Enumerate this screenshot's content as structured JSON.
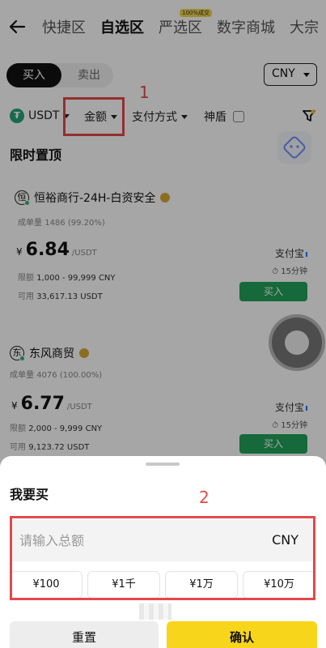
{
  "nav": {
    "tabs": [
      {
        "label": "快捷区"
      },
      {
        "label": "自选区"
      },
      {
        "label": "严选区",
        "badge": "100%成交"
      },
      {
        "label": "数字商城"
      },
      {
        "label": "大宗"
      }
    ]
  },
  "trade": {
    "buy_label": "买入",
    "sell_label": "卖出",
    "currency": "CNY"
  },
  "filters": {
    "coin": "USDT",
    "amount": "金额",
    "payment": "支付方式",
    "shield": "神盾"
  },
  "annotations": {
    "label1": "1",
    "label2": "2"
  },
  "section_title": "限时置顶",
  "cards": [
    {
      "merchant": "恒裕商行-24H-白资安全",
      "avatar_char": "恒",
      "stats_label": "成单量",
      "stats_value": "1486 (99.20%)",
      "currency_symbol": "¥",
      "price": "6.84",
      "unit": "/USDT",
      "limit_label": "限额",
      "limit_value": "1,000 - 99,999 CNY",
      "avail_label": "可用",
      "avail_value": "33,617.13 USDT",
      "payment": "支付宝",
      "time": "15分钟",
      "buy_label": "买入"
    },
    {
      "merchant": "东风商贸",
      "avatar_char": "东",
      "stats_label": "成单量",
      "stats_value": "4076 (100.00%)",
      "currency_symbol": "¥",
      "price": "6.77",
      "unit": "/USDT",
      "limit_label": "限额",
      "limit_value": "2,000 - 9,999 CNY",
      "avail_label": "可用",
      "avail_value": "9,123.72 USDT",
      "payment": "支付宝",
      "time": "15分钟",
      "buy_label": "买入"
    }
  ],
  "sheet": {
    "title": "我要买",
    "input_placeholder": "请输入总额",
    "input_value": "",
    "input_unit": "CNY",
    "quick_amounts": [
      "¥100",
      "¥1千",
      "¥1万",
      "¥10万"
    ],
    "reset_label": "重置",
    "confirm_label": "确认"
  }
}
